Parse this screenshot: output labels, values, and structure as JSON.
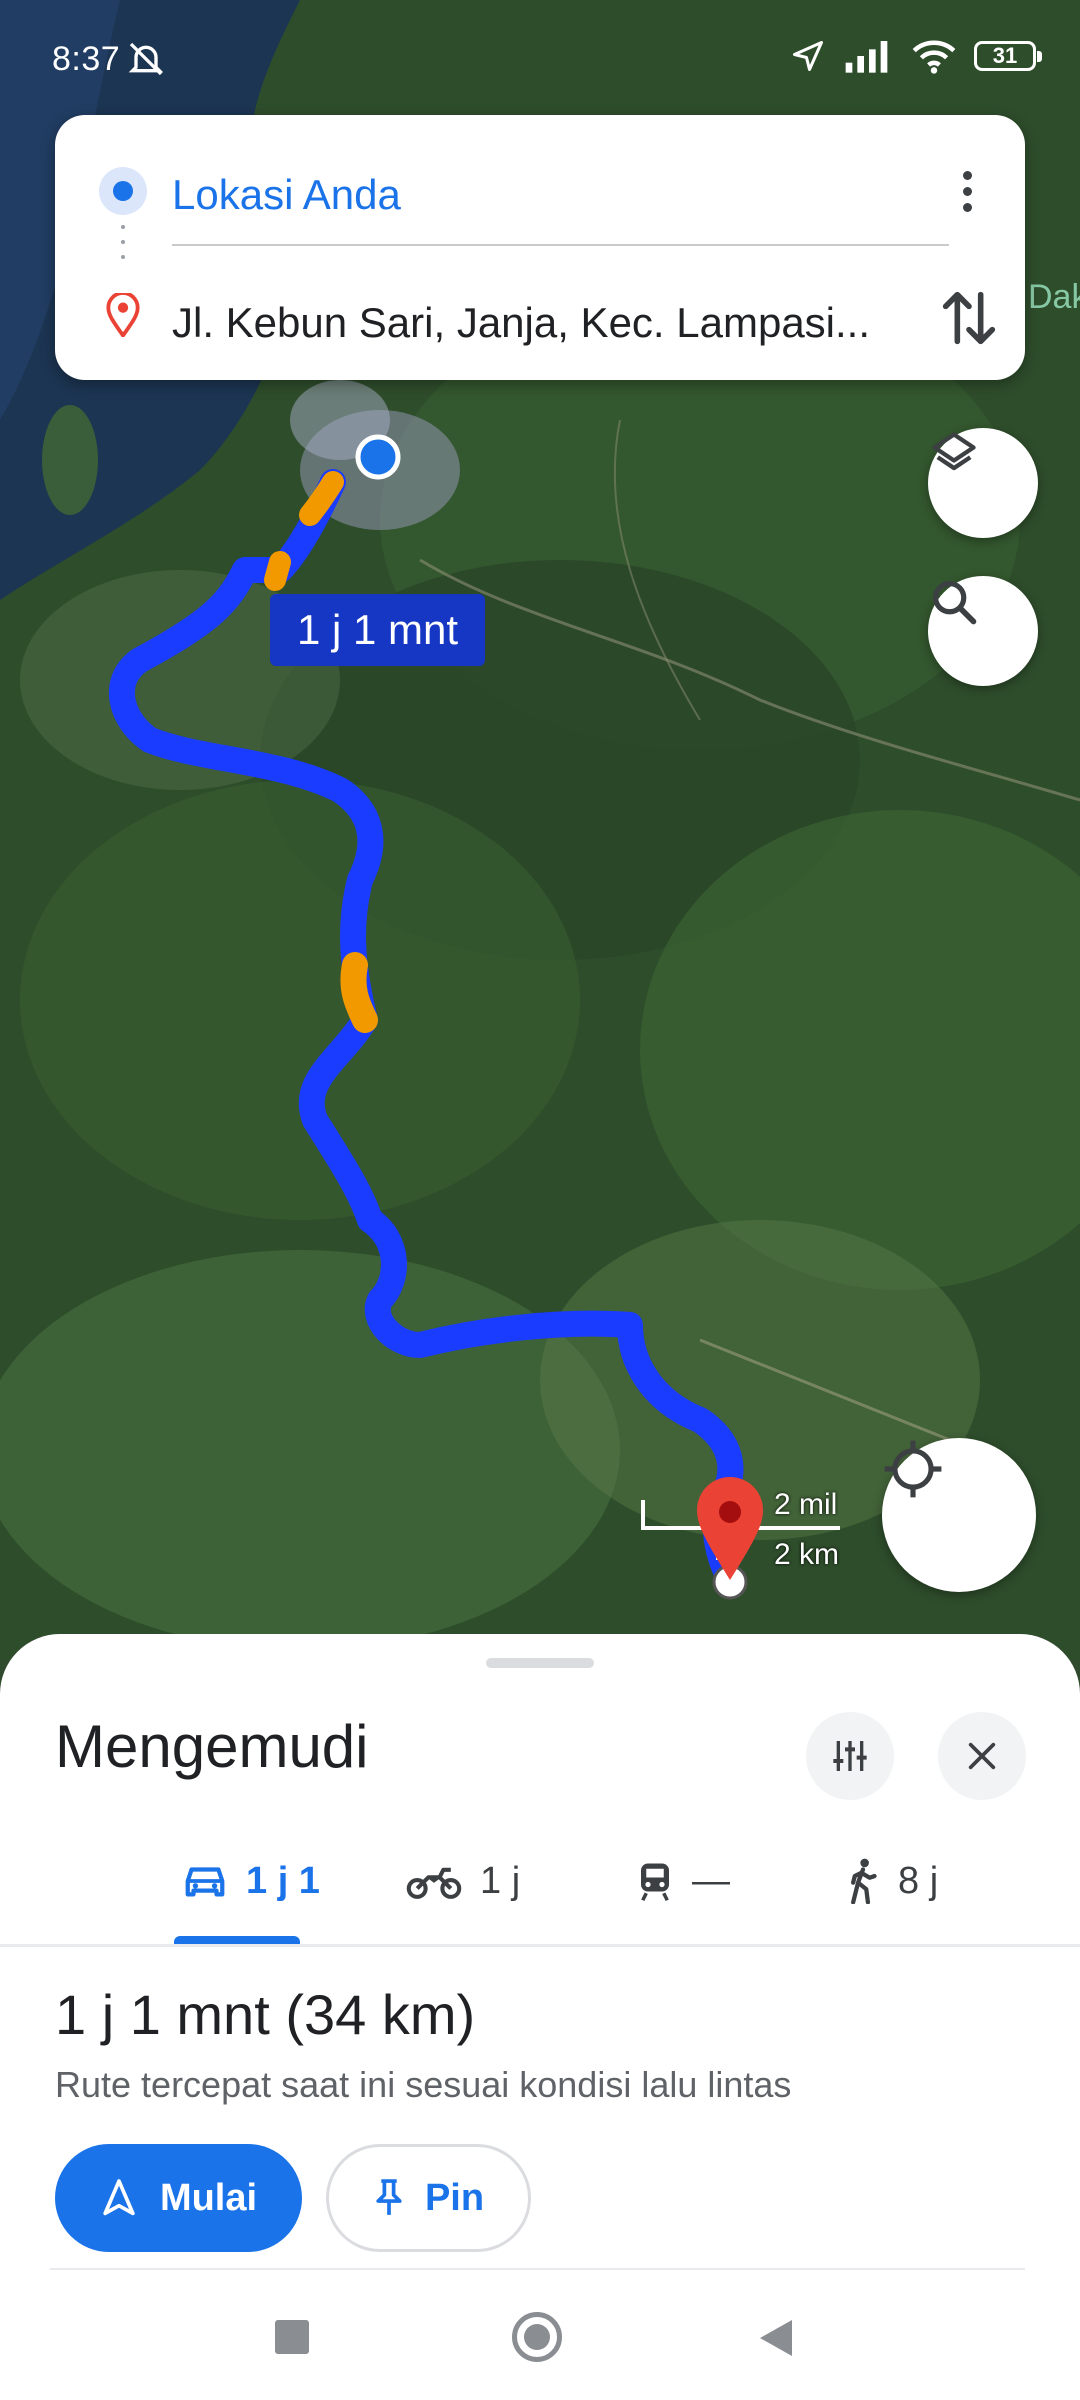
{
  "status_bar": {
    "time": "8:37",
    "battery": "31"
  },
  "route_card": {
    "origin": "Lokasi Anda",
    "destination": "Jl. Kebun Sari, Janja, Kec. Lampasi..."
  },
  "map": {
    "eta_label": "1 j 1 mnt",
    "partial_place_label": "Dak",
    "scale_miles": "2 mil",
    "scale_km": "2 km",
    "colors": {
      "route": "#1a3cff",
      "traffic_slow": "#f29900",
      "destination_marker": "#ea4335"
    }
  },
  "sheet": {
    "title": "Mengemudi",
    "modes": [
      {
        "icon": "car-icon",
        "label": "1 j 1",
        "selected": true
      },
      {
        "icon": "motorcycle-icon",
        "label": "1 j"
      },
      {
        "icon": "train-icon",
        "label": "—"
      },
      {
        "icon": "walk-icon",
        "label": "8 j"
      }
    ],
    "summary": "1 j 1 mnt (34 km)",
    "note": "Rute tercepat saat ini sesuai kondisi lalu lintas",
    "start_label": "Mulai",
    "pin_label": "Pin"
  },
  "accent_color": "#1a73e8"
}
